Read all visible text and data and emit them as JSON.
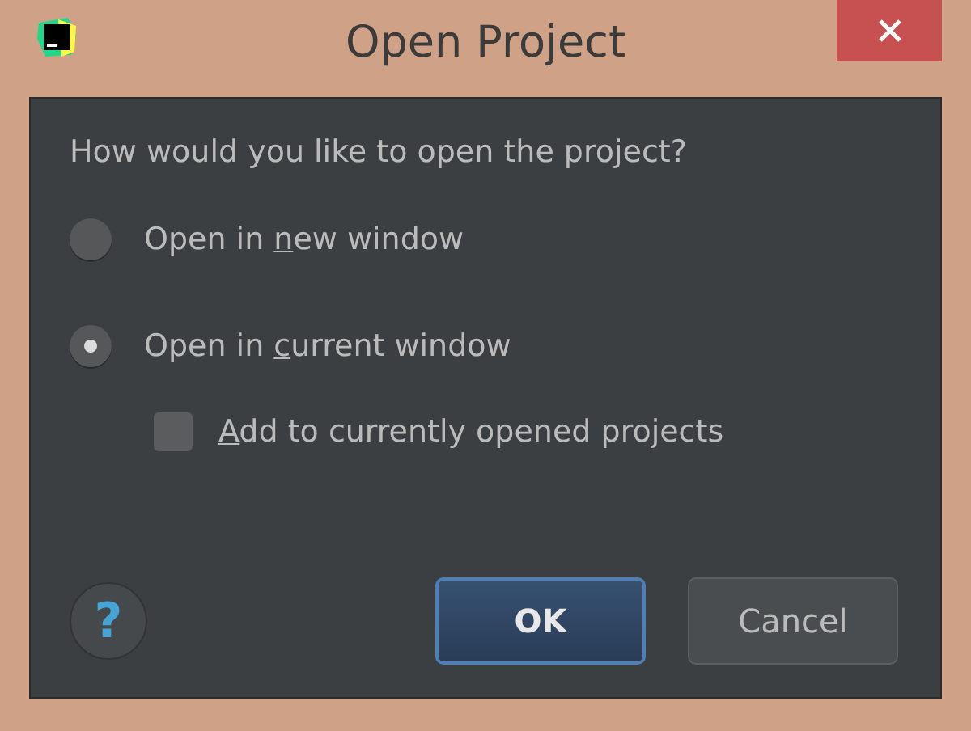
{
  "window": {
    "title": "Open Project"
  },
  "question": "How would you like to open the project?",
  "options": [
    {
      "kind": "radio",
      "label": {
        "pre": "Open in ",
        "key": "n",
        "post": "ew window"
      },
      "selected": false
    },
    {
      "kind": "radio",
      "label": {
        "pre": "Open in ",
        "key": "c",
        "post": "urrent window"
      },
      "selected": true
    },
    {
      "kind": "checkbox",
      "label": {
        "key": "A",
        "post": "dd to currently opened projects"
      },
      "checked": false
    }
  ],
  "help": "?",
  "buttons": [
    {
      "label": "OK",
      "default": true
    },
    {
      "label": "Cancel",
      "default": false
    }
  ]
}
